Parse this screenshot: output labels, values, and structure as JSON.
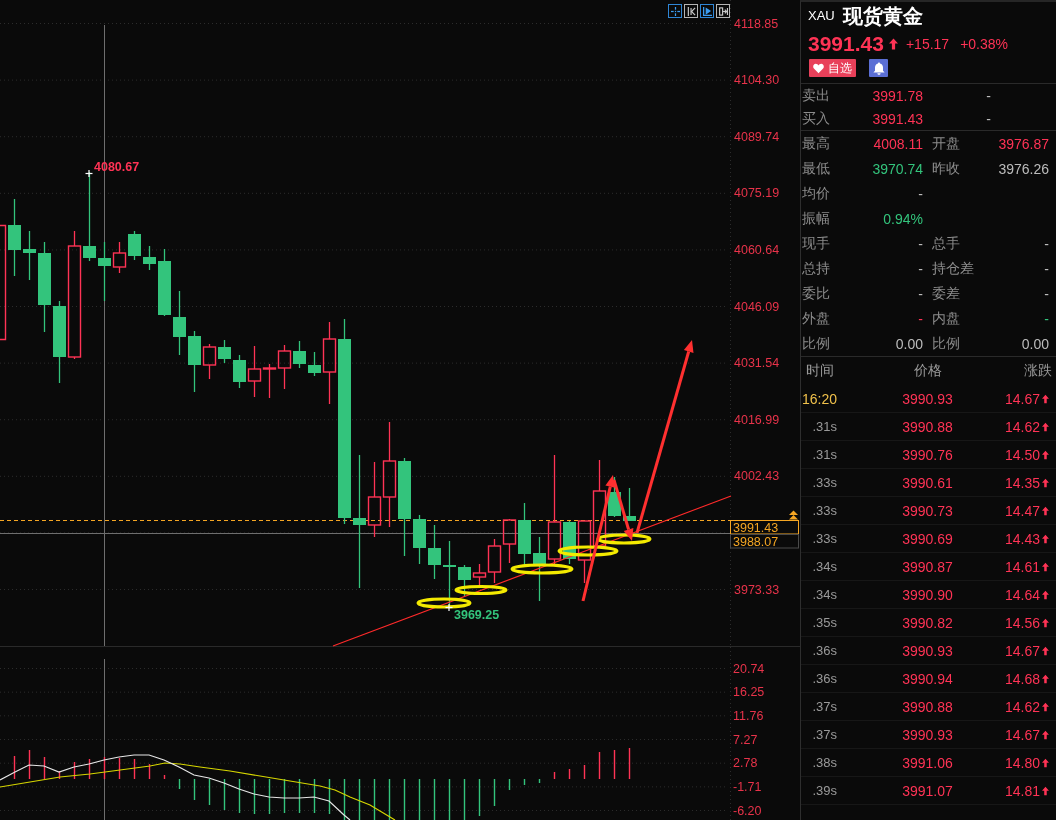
{
  "toolbar": {
    "tools": [
      {
        "selected": true
      },
      {
        "selected": false
      },
      {
        "selected": true
      },
      {
        "selected": false
      }
    ]
  },
  "chart": {
    "price_axis": [
      "4118.85",
      "4104.30",
      "4089.74",
      "4075.19",
      "4060.64",
      "4046.09",
      "4031.54",
      "4016.99",
      "4002.43",
      "3973.33"
    ],
    "high_label": "4080.67",
    "low_label": "3969.25",
    "price_tags": [
      {
        "kind": "last",
        "text": "3991.43"
      },
      {
        "kind": "cursor",
        "text": "3988.07"
      }
    ]
  },
  "indicator": {
    "axis": [
      "20.74",
      "16.25",
      "11.76",
      "7.27",
      "2.78",
      "-1.71",
      "-6.20"
    ]
  },
  "quote": {
    "symbol": "XAU",
    "name": "现货黄金",
    "price": "3991.43",
    "color": "#ff3355",
    "change": "+15.17",
    "change_percent": "+0.38%",
    "watch_button": "自选"
  },
  "order_book": [
    {
      "label": "卖出",
      "price": "3991.78",
      "color": "#ff3355",
      "volume": "-"
    },
    {
      "label": "买入",
      "price": "3991.43",
      "color": "#ff3355",
      "volume": "-"
    }
  ],
  "stats": [
    {
      "cells": [
        {
          "label": "最高",
          "value": "4008.11",
          "color": "#ff3355"
        },
        {
          "label": "开盘",
          "value": "3976.87",
          "color": "#ff3355"
        }
      ]
    },
    {
      "cells": [
        {
          "label": "最低",
          "value": "3970.74",
          "color": "#33c47c"
        },
        {
          "label": "昨收",
          "value": "3976.26",
          "color": "#bcbcbc"
        }
      ]
    },
    {
      "cells": [
        {
          "label": "均价",
          "value": "-",
          "color": "#bcbcbc"
        }
      ]
    },
    {
      "cells": [
        {
          "label": "振幅",
          "value": "0.94%",
          "color": "#33c47c"
        }
      ]
    },
    {
      "cells": [
        {
          "label": "现手",
          "value": "-",
          "color": "#bcbcbc"
        },
        {
          "label": "总手",
          "value": "-",
          "color": "#bcbcbc"
        }
      ]
    },
    {
      "cells": [
        {
          "label": "总持",
          "value": "-",
          "color": "#bcbcbc"
        },
        {
          "label": "持仓差",
          "value": "-",
          "color": "#bcbcbc"
        }
      ]
    },
    {
      "cells": [
        {
          "label": "委比",
          "value": "-",
          "color": "#bcbcbc"
        },
        {
          "label": "委差",
          "value": "-",
          "color": "#bcbcbc"
        }
      ]
    },
    {
      "cells": [
        {
          "label": "外盘",
          "value": "-",
          "color": "#ff3355"
        },
        {
          "label": "内盘",
          "value": "-",
          "color": "#33c47c"
        }
      ]
    },
    {
      "cells": [
        {
          "label": "比例",
          "value": "0.00",
          "color": "#bcbcbc"
        },
        {
          "label": "比例",
          "value": "0.00",
          "color": "#bcbcbc"
        }
      ]
    }
  ],
  "trades": {
    "columns": [
      "时间",
      "价格",
      "涨跌"
    ],
    "rows": [
      {
        "kind": "minute",
        "time": "16:20",
        "price": "3990.93",
        "change": "14.67",
        "color": "#ff3355"
      },
      {
        "kind": "second",
        "time": ".31s",
        "price": "3990.88",
        "change": "14.62",
        "color": "#ff3355"
      },
      {
        "kind": "second",
        "time": ".31s",
        "price": "3990.76",
        "change": "14.50",
        "color": "#ff3355"
      },
      {
        "kind": "second",
        "time": ".33s",
        "price": "3990.61",
        "change": "14.35",
        "color": "#ff3355"
      },
      {
        "kind": "second",
        "time": ".33s",
        "price": "3990.73",
        "change": "14.47",
        "color": "#ff3355"
      },
      {
        "kind": "second",
        "time": ".33s",
        "price": "3990.69",
        "change": "14.43",
        "color": "#ff3355"
      },
      {
        "kind": "second",
        "time": ".34s",
        "price": "3990.87",
        "change": "14.61",
        "color": "#ff3355"
      },
      {
        "kind": "second",
        "time": ".34s",
        "price": "3990.90",
        "change": "14.64",
        "color": "#ff3355"
      },
      {
        "kind": "second",
        "time": ".35s",
        "price": "3990.82",
        "change": "14.56",
        "color": "#ff3355"
      },
      {
        "kind": "second",
        "time": ".36s",
        "price": "3990.93",
        "change": "14.67",
        "color": "#ff3355"
      },
      {
        "kind": "second",
        "time": ".36s",
        "price": "3990.94",
        "change": "14.68",
        "color": "#ff3355"
      },
      {
        "kind": "second",
        "time": ".37s",
        "price": "3990.88",
        "change": "14.62",
        "color": "#ff3355"
      },
      {
        "kind": "second",
        "time": ".37s",
        "price": "3990.93",
        "change": "14.67",
        "color": "#ff3355"
      },
      {
        "kind": "second",
        "time": ".38s",
        "price": "3991.06",
        "change": "14.80",
        "color": "#ff3355"
      },
      {
        "kind": "second",
        "time": ".39s",
        "price": "3991.07",
        "change": "14.81",
        "color": "#ff3355"
      }
    ]
  }
}
